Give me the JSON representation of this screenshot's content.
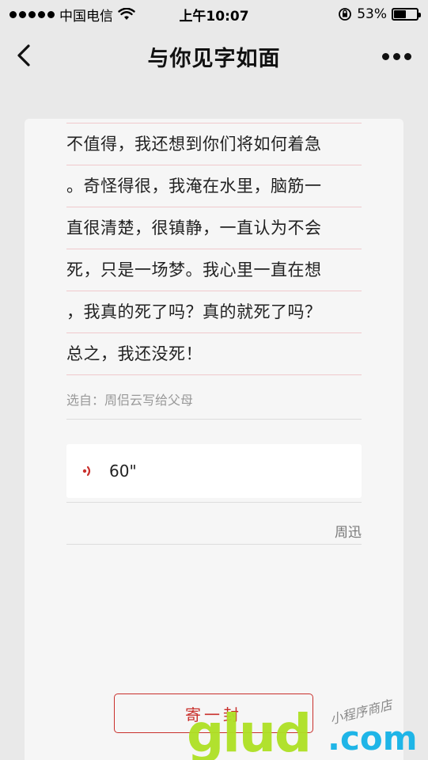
{
  "status_bar": {
    "carrier": "中国电信",
    "time": "上午10:07",
    "battery_percent": "53%",
    "battery_level": 0.53
  },
  "nav": {
    "title": "与你见字如面"
  },
  "letter": {
    "lines": [
      "不值得，我还想到你们将如何着急",
      "。奇怪得很，我淹在水里，脑筋一",
      "直很清楚，很镇静，一直认为不会",
      "死，只是一场梦。我心里一直在想",
      "，我真的死了吗？真的就死了吗？",
      "总之，我还没死！"
    ],
    "source": "选自：周侣云写给父母",
    "audio_duration": "60\"",
    "signature": "周迅"
  },
  "actions": {
    "send_label": "寄一封"
  },
  "watermark": {
    "main": "glud",
    "suffix": ".com",
    "small": "小程序商店"
  },
  "colors": {
    "accent_red": "#c9302c",
    "rule_pink": "#f0c8cc",
    "watermark_green": "#aee024",
    "watermark_blue": "#1fb5e7"
  },
  "icons": {
    "back": "chevron-left-icon",
    "more": "more-dots-icon",
    "audio": "sound-wave-icon",
    "wifi": "wifi-icon",
    "orientation_lock": "orientation-lock-icon",
    "battery": "battery-icon"
  }
}
